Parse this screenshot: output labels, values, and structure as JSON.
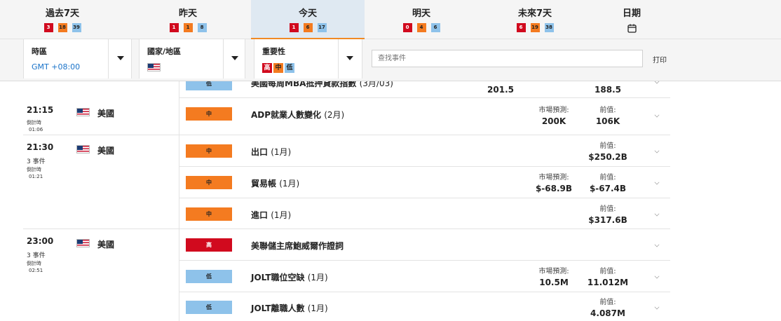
{
  "tabs": [
    {
      "label": "過去7天",
      "counts": [
        3,
        18,
        39
      ]
    },
    {
      "label": "昨天",
      "counts": [
        1,
        1,
        8
      ]
    },
    {
      "label": "今天",
      "counts": [
        1,
        6,
        17
      ]
    },
    {
      "label": "明天",
      "counts": [
        0,
        4,
        6
      ]
    },
    {
      "label": "未來7天",
      "counts": [
        6,
        19,
        38
      ]
    },
    {
      "label": "日期",
      "icon": "calendar-icon"
    }
  ],
  "filters": {
    "timezone": {
      "label": "時區",
      "value": "GMT +08:00"
    },
    "country": {
      "label": "國家/地區",
      "icon": "us-flag-icon"
    },
    "importance": {
      "label": "重要性",
      "levels": [
        "高",
        "中",
        "低"
      ]
    },
    "search_placeholder": "查找事件",
    "print_label": "打印"
  },
  "colors": {
    "high": "#d10a1e",
    "medium": "#f47b20",
    "low": "#8ec2ea",
    "accent": "#1a73c9"
  },
  "partial_event": {
    "importance": "低",
    "name": "美國每周MBA抵押貸款指數",
    "period": "(3月/03)",
    "actual": "201.5",
    "previous": "188.5"
  },
  "groups": [
    {
      "time": "21:15",
      "events_count": "",
      "countdown_label": "倒計時",
      "countdown": "01:06",
      "country": "美國",
      "events": [
        {
          "importance": "中",
          "name": "ADP就業人數變化",
          "period": "(2月)",
          "forecast_label": "市場預測:",
          "forecast": "200K",
          "previous_label": "前值:",
          "previous": "106K"
        }
      ]
    },
    {
      "time": "21:30",
      "events_count": "3 事件",
      "countdown_label": "倒計時",
      "countdown": "01:21",
      "country": "美國",
      "events": [
        {
          "importance": "中",
          "name": "出口",
          "period": "(1月)",
          "forecast_label": "",
          "forecast": "",
          "previous_label": "前值:",
          "previous": "$250.2B"
        },
        {
          "importance": "中",
          "name": "貿易帳",
          "period": "(1月)",
          "forecast_label": "市場預測:",
          "forecast": "$-68.9B",
          "previous_label": "前值:",
          "previous": "$-67.4B"
        },
        {
          "importance": "中",
          "name": "進口",
          "period": "(1月)",
          "forecast_label": "",
          "forecast": "",
          "previous_label": "前值:",
          "previous": "$317.6B"
        }
      ]
    },
    {
      "time": "23:00",
      "events_count": "3 事件",
      "countdown_label": "倒計時",
      "countdown": "02:51",
      "country": "美國",
      "events": [
        {
          "importance": "高",
          "name": "美聯儲主席鮑威爾作證詞",
          "period": "",
          "forecast_label": "",
          "forecast": "",
          "previous_label": "",
          "previous": ""
        },
        {
          "importance": "低",
          "name": "JOLT職位空缺",
          "period": "(1月)",
          "forecast_label": "市場預測:",
          "forecast": "10.5M",
          "previous_label": "前值:",
          "previous": "11.012M"
        },
        {
          "importance": "低",
          "name": "JOLT離職人數",
          "period": "(1月)",
          "forecast_label": "",
          "forecast": "",
          "previous_label": "前值:",
          "previous": "4.087M"
        }
      ]
    }
  ]
}
